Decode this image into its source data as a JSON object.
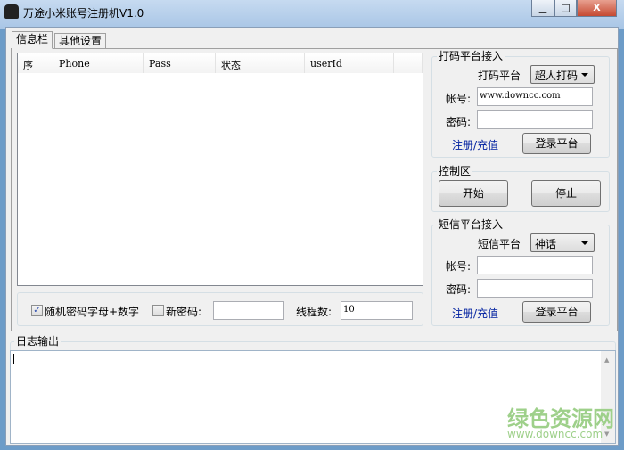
{
  "window": {
    "title": "万途小米账号注册机V1.0",
    "minimize": "▁",
    "maximize": "□",
    "close": "X"
  },
  "tabs": [
    {
      "label": "信息栏",
      "active": true
    },
    {
      "label": "其他设置",
      "active": false
    }
  ],
  "table": {
    "columns": [
      "序",
      "Phone",
      "Pass",
      "状态",
      "userId"
    ],
    "rows": []
  },
  "options": {
    "random_pwd_label": "随机密码字母+数字",
    "random_pwd_checked": true,
    "new_pwd_label": "新密码:",
    "new_pwd_checked": false,
    "new_pwd_value": "",
    "threads_label": "线程数:",
    "threads_value": "10"
  },
  "captcha": {
    "group": "打码平台接入",
    "platform_label": "打码平台",
    "platform_value": "超人打码",
    "account_label": "帐号:",
    "account_value": "www.downcc.com",
    "password_label": "密码:",
    "password_value": "",
    "register_link": "注册/充值",
    "login_button": "登录平台"
  },
  "control": {
    "group": "控制区",
    "start": "开始",
    "stop": "停止"
  },
  "sms": {
    "group": "短信平台接入",
    "platform_label": "短信平台",
    "platform_value": "神话",
    "account_label": "帐号:",
    "account_value": "",
    "password_label": "密码:",
    "password_value": "",
    "register_link": "注册/充值",
    "login_button": "登录平台"
  },
  "log": {
    "group": "日志输出",
    "content": ""
  },
  "watermark": {
    "brand": "绿色资源网",
    "url": "www.downcc.com"
  }
}
